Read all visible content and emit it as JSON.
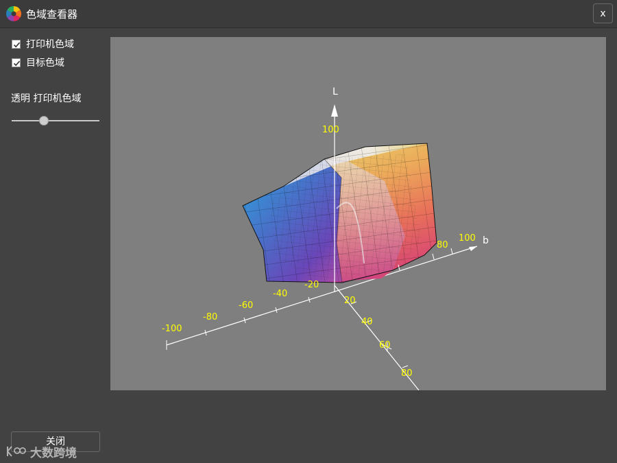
{
  "window": {
    "title": "色域查看器",
    "close_glyph": "x",
    "icon": "color-wheel-icon"
  },
  "options": {
    "printer_gamut": {
      "label": "打印机色域",
      "checked": true
    },
    "target_gamut": {
      "label": "目标色域",
      "checked": true
    }
  },
  "opacity": {
    "label": "透明 打印机色域",
    "value": 0.37
  },
  "viewer": {
    "background": "#7f7f7f",
    "axes": {
      "L": {
        "name": "L",
        "ticks": [
          "100"
        ]
      },
      "b": {
        "name": "b",
        "ticks": [
          "-100",
          "-80",
          "-60",
          "-40",
          "-20",
          "80",
          "100"
        ]
      },
      "a": {
        "ticks": [
          "20",
          "40",
          "60",
          "80"
        ]
      }
    },
    "label_color": "#ffff00"
  },
  "footer": {
    "close_label": "关闭",
    "watermark": "大数跨境"
  }
}
